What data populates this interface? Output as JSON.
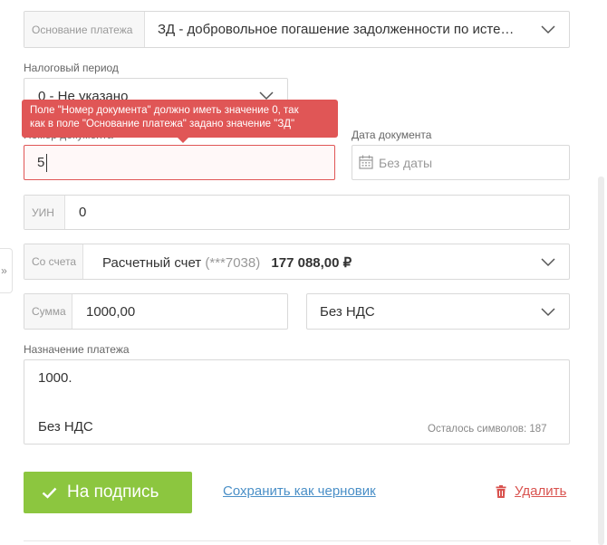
{
  "basis": {
    "prefix": "Основание платежа",
    "value": "ЗД - добровольное погашение задолженности по исте…"
  },
  "tax_period": {
    "label": "Налоговый период",
    "value": "0 - Не указано"
  },
  "tooltip": {
    "line1": "Поле \"Номер документа\" должно иметь значение 0, так",
    "line2": "как в поле \"Основание платежа\" задано значение \"ЗД\""
  },
  "doc_number": {
    "label": "Номер документа",
    "value": "5"
  },
  "doc_date": {
    "label": "Дата документа",
    "placeholder": "Без даты"
  },
  "uin": {
    "prefix": "УИН",
    "value": "0"
  },
  "account": {
    "prefix": "Со счета",
    "name": "Расчетный счет",
    "mask": "(***7038)",
    "balance": "177 088,00 ₽"
  },
  "amount": {
    "prefix": "Сумма",
    "value": "1000,00"
  },
  "vat": {
    "value": "Без НДС"
  },
  "purpose": {
    "label": "Назначение платежа",
    "line1": "1000.",
    "line2": "Без НДС",
    "counter": "Осталось символов: 187"
  },
  "actions": {
    "sign": "На подпись",
    "draft": "Сохранить как черновик",
    "delete": "Удалить"
  },
  "colors": {
    "accent_green": "#8cc63f",
    "error_red": "#e05656",
    "link_blue": "#4a8fc7",
    "delete_red": "#d9534f"
  }
}
